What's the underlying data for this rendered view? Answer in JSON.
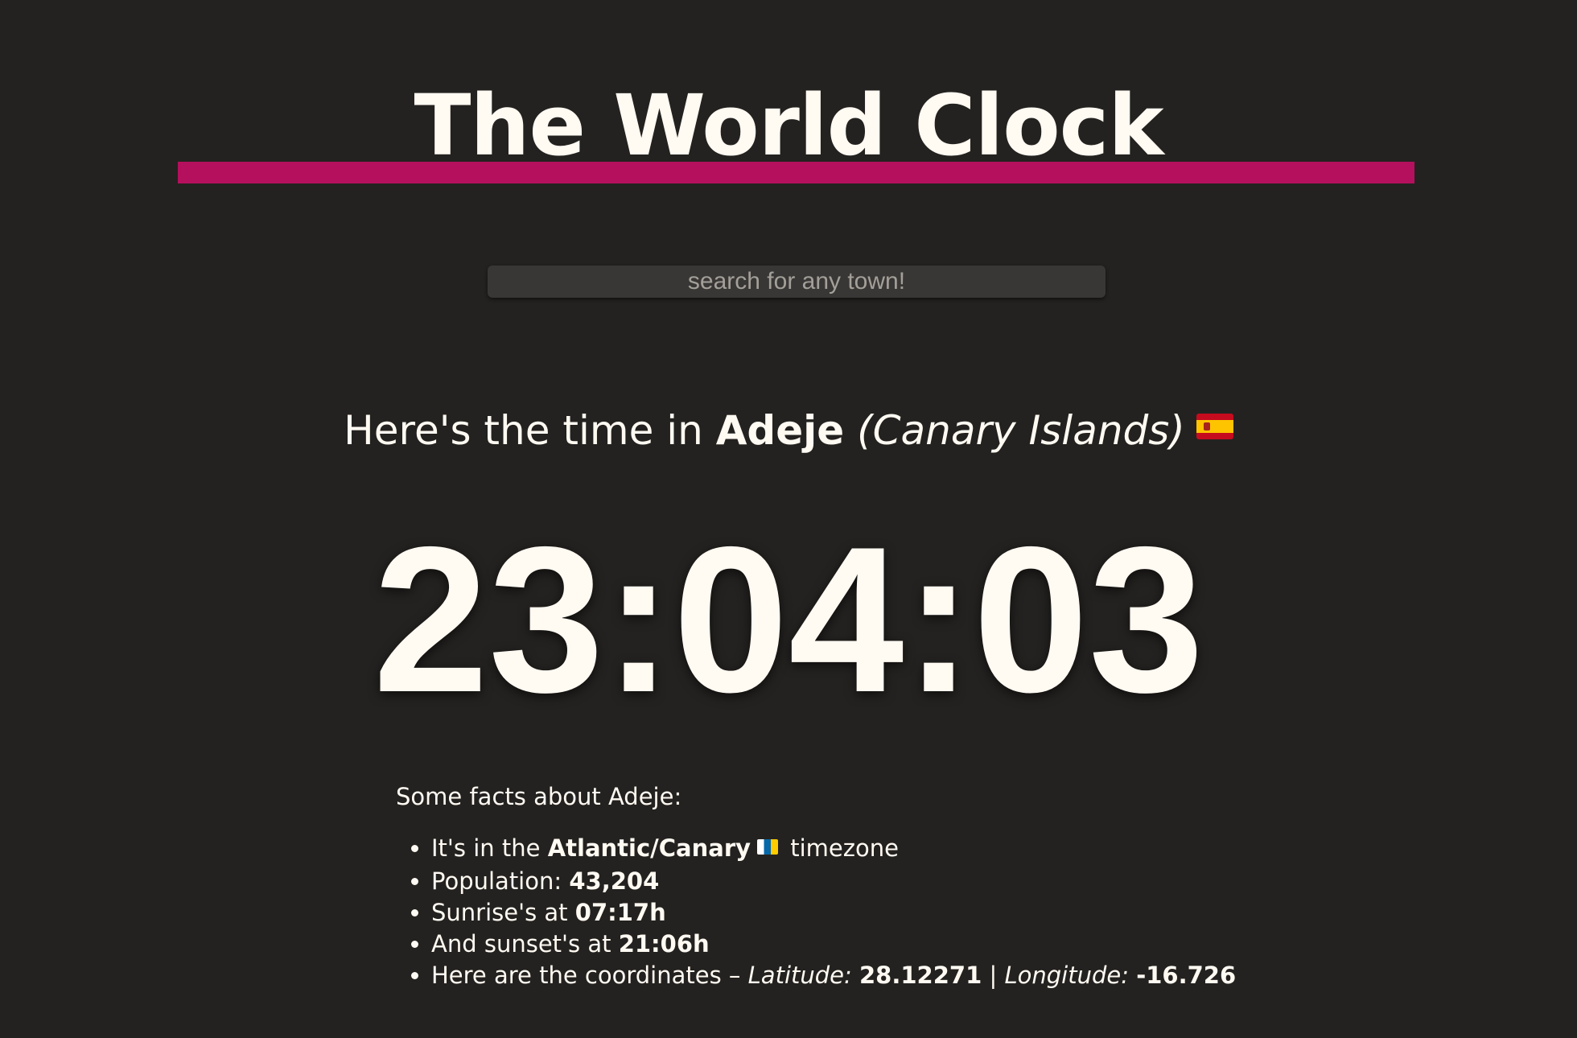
{
  "title": "The World Clock",
  "colors": {
    "background": "#242220",
    "accent_bar": "#b5105e",
    "text": "#fffaf2",
    "search_bg": "#393735"
  },
  "search": {
    "placeholder": "search for any town!",
    "value": ""
  },
  "headline": {
    "prefix": "Here's the time in ",
    "city": "Adeje",
    "region": "(Canary Islands)",
    "flag_icon": "spain-flag-icon"
  },
  "clock": {
    "time": "23:04:03"
  },
  "facts": {
    "heading": "Some facts about Adeje:",
    "timezone": {
      "prefix": "It's in the ",
      "value": "Atlantic/Canary",
      "flag_icon": "canary-islands-flag-icon",
      "suffix": " timezone"
    },
    "population": {
      "prefix": "Population: ",
      "value": "43,204"
    },
    "sunrise": {
      "prefix": "Sunrise's at ",
      "value": "07:17h"
    },
    "sunset": {
      "prefix": "And sunset's at ",
      "value": "21:06h"
    },
    "coordinates": {
      "prefix": "Here are the coordinates – ",
      "latitude_label": "Latitude:",
      "latitude": "28.12271",
      "separator": " | ",
      "longitude_label": "Longitude:",
      "longitude": "-16.726"
    }
  }
}
